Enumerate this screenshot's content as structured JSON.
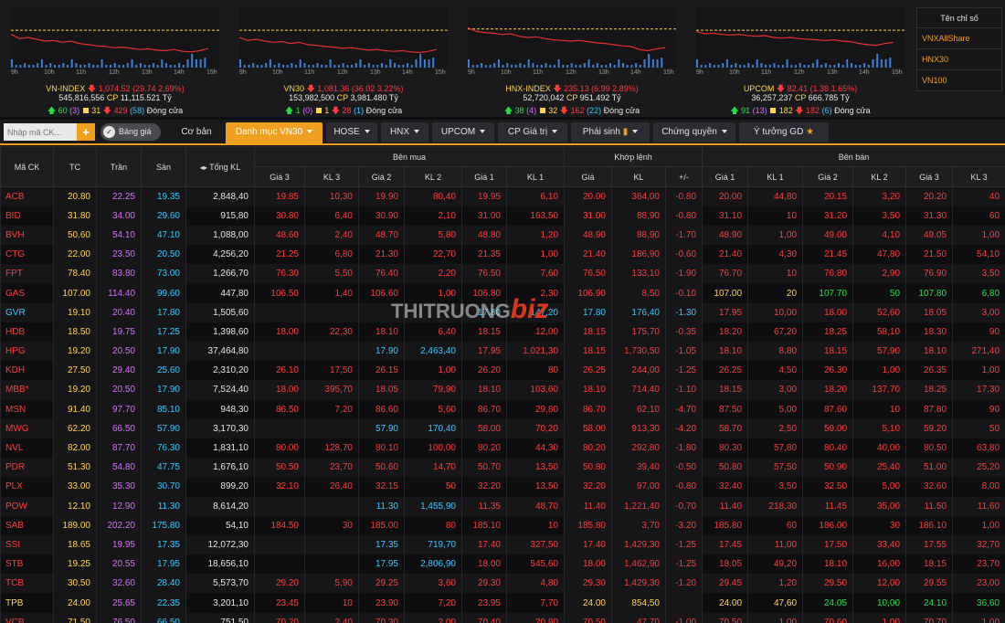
{
  "indices": [
    {
      "name": "VN-INDEX",
      "value": "1,074.52",
      "change": "(29.74 2.69%)",
      "volume": "545,816,556",
      "cp_label": "CP",
      "value_traded": "11,115.521 Tỷ",
      "up": "60",
      "ceil": "(3)",
      "ref": "31",
      "down": "429",
      "floor": "(58)",
      "status": "Đóng cửa",
      "chart_data": {
        "type": "line",
        "ref_level": 0.62,
        "series": [
          {
            "name": "price",
            "values": [
              0.55,
              0.48,
              0.5,
              0.47,
              0.44,
              0.45,
              0.42,
              0.44,
              0.4,
              0.38,
              0.36,
              0.35,
              0.33,
              0.34,
              0.32,
              0.3,
              0.31,
              0.29,
              0.28,
              0.3,
              0.27,
              0.26,
              0.28,
              0.32
            ]
          }
        ]
      }
    },
    {
      "name": "VN30",
      "value": "1,081.36",
      "change": "(36.02 3.22%)",
      "volume": "153,982,500",
      "cp_label": "CP",
      "value_traded": "3,981.480 Tỷ",
      "up": "1",
      "ceil": "(0)",
      "ref": "1",
      "down": "28",
      "floor": "(1)",
      "status": "Đóng cửa",
      "chart_data": {
        "type": "line",
        "ref_level": 0.62,
        "series": [
          {
            "name": "price",
            "values": [
              0.5,
              0.45,
              0.47,
              0.44,
              0.42,
              0.43,
              0.4,
              0.42,
              0.38,
              0.37,
              0.35,
              0.34,
              0.32,
              0.33,
              0.31,
              0.29,
              0.3,
              0.28,
              0.27,
              0.28,
              0.26,
              0.25,
              0.27,
              0.3
            ]
          }
        ]
      }
    },
    {
      "name": "HNX-INDEX",
      "value": "235.13",
      "change": "(6.99 2.89%)",
      "volume": "52,720,042",
      "cp_label": "CP",
      "value_traded": "951.492 Tỷ",
      "up": "38",
      "ceil": "(4)",
      "ref": "32",
      "down": "162",
      "floor": "(22)",
      "status": "Đóng cửa",
      "chart_data": {
        "type": "line",
        "ref_level": 0.64,
        "series": [
          {
            "name": "price",
            "values": [
              0.66,
              0.6,
              0.58,
              0.57,
              0.55,
              0.56,
              0.52,
              0.5,
              0.51,
              0.48,
              0.46,
              0.45,
              0.44,
              0.45,
              0.43,
              0.41,
              0.4,
              0.38,
              0.36,
              0.35,
              0.3,
              0.28,
              0.31,
              0.33
            ]
          }
        ]
      }
    },
    {
      "name": "UPCOM",
      "value": "82.41",
      "change": "(1.38 1.65%)",
      "volume": "36,257,237",
      "cp_label": "CP",
      "value_traded": "666.785 Tỷ",
      "up": "91",
      "ceil": "(13)",
      "ref": "182",
      "down": "182",
      "floor": "(6)",
      "status": "Đóng cửa",
      "chart_data": {
        "type": "line",
        "ref_level": 0.62,
        "series": [
          {
            "name": "price",
            "values": [
              0.6,
              0.56,
              0.57,
              0.55,
              0.54,
              0.55,
              0.53,
              0.52,
              0.53,
              0.5,
              0.49,
              0.5,
              0.48,
              0.47,
              0.46,
              0.45,
              0.46,
              0.44,
              0.43,
              0.4,
              0.38,
              0.37,
              0.4,
              0.42
            ]
          }
        ]
      }
    }
  ],
  "axis_ticks": [
    "9h",
    "10h",
    "11h",
    "12h",
    "13h",
    "14h",
    "15h"
  ],
  "index_list": {
    "header": "Tên chỉ số",
    "items": [
      "VNXAllShare",
      "HNX30",
      "VN100"
    ]
  },
  "toolbar": {
    "search_placeholder": "Nhập mã CK...",
    "plus": "+",
    "toggle_label": "Bảng giá",
    "tabs": [
      "Cơ bản",
      "Danh mục VN30",
      "HOSE",
      "HNX",
      "UPCOM",
      "CP Giá trị",
      "Phái sinh",
      "Chứng quyền",
      "Ý tưởng GD"
    ]
  },
  "table": {
    "group_headers": [
      "Bên mua",
      "Khớp lệnh",
      "Bên bán"
    ],
    "headers": [
      "Mã CK",
      "TC",
      "Trần",
      "Sàn",
      "Tổng KL",
      "Giá 3",
      "KL 3",
      "Giá 2",
      "KL 2",
      "Giá 1",
      "KL 1",
      "Giá",
      "KL",
      "+/-",
      "Giá 1",
      "KL 1",
      "Giá 2",
      "KL 2",
      "Giá 3",
      "KL 3"
    ],
    "rows": [
      [
        "ACB",
        "20.80",
        "22.25",
        "19.35",
        "2,848,40",
        "19.85",
        "10,30",
        "19.90",
        "80,40",
        "19.95",
        "6,10",
        "20.00",
        "364,00",
        "-0.80",
        "20.00",
        "44,80",
        "20.15",
        "3,20",
        "20.20",
        "40"
      ],
      [
        "BID",
        "31.80",
        "34.00",
        "29.60",
        "915,80",
        "30.80",
        "6,40",
        "30.90",
        "2,10",
        "31.00",
        "163,50",
        "31.00",
        "88,90",
        "-0.80",
        "31.10",
        "10",
        "31.20",
        "3,50",
        "31.30",
        "60"
      ],
      [
        "BVH",
        "50.60",
        "54.10",
        "47.10",
        "1,088,00",
        "48.60",
        "2,40",
        "48.70",
        "5,80",
        "48.80",
        "1,20",
        "48.90",
        "88,90",
        "-1.70",
        "48.90",
        "1,00",
        "49.00",
        "4,10",
        "49.05",
        "1,00"
      ],
      [
        "CTG",
        "22.00",
        "23.50",
        "20.50",
        "4,256,20",
        "21.25",
        "6,80",
        "21.30",
        "22,70",
        "21.35",
        "1,00",
        "21.40",
        "186,90",
        "-0.60",
        "21.40",
        "4,30",
        "21.45",
        "47,80",
        "21.50",
        "54,10"
      ],
      [
        "FPT",
        "78.40",
        "83.80",
        "73.00",
        "1,266,70",
        "76.30",
        "5,50",
        "76.40",
        "2,20",
        "76.50",
        "7,60",
        "76.50",
        "133,10",
        "-1.90",
        "76.70",
        "10",
        "76.80",
        "2,90",
        "76.90",
        "3,50"
      ],
      [
        "GAS",
        "107.00",
        "114.40",
        "99.60",
        "447,80",
        "106.50",
        "1,40",
        "106.60",
        "1,00",
        "106.80",
        "2,30",
        "106.90",
        "8,50",
        "-0.10",
        "107.00",
        "20",
        "107.70",
        "50",
        "107.80",
        "6,80"
      ],
      [
        "GVR",
        "19.10",
        "20.40",
        "17.80",
        "1,505,60",
        "",
        "",
        "",
        "",
        "17.80",
        "147,20",
        "17.80",
        "176,40",
        "-1.30",
        "17.95",
        "10,00",
        "18.00",
        "52,60",
        "18.05",
        "3,00"
      ],
      [
        "HDB",
        "18.50",
        "19.75",
        "17.25",
        "1,398,60",
        "18.00",
        "22,30",
        "18.10",
        "6,40",
        "18.15",
        "12,00",
        "18.15",
        "175,70",
        "-0.35",
        "18.20",
        "67,20",
        "18.25",
        "58,10",
        "18.30",
        "90"
      ],
      [
        "HPG",
        "19.20",
        "20.50",
        "17.90",
        "37,464,80",
        "",
        "",
        "17.90",
        "2,463,40",
        "17.95",
        "1,021,30",
        "18.15",
        "1,730,50",
        "-1.05",
        "18.10",
        "8,80",
        "18.15",
        "57,90",
        "18.10",
        "271,40"
      ],
      [
        "KDH",
        "27.50",
        "29.40",
        "25.60",
        "2,310,20",
        "26.10",
        "17,50",
        "26.15",
        "1,00",
        "26.20",
        "80",
        "26.25",
        "244,00",
        "-1.25",
        "26.25",
        "4,50",
        "26.30",
        "1,00",
        "26.35",
        "1,00"
      ],
      [
        "MBB*",
        "19.20",
        "20.50",
        "17.90",
        "7,524,40",
        "18.00",
        "395,70",
        "18.05",
        "79,90",
        "18.10",
        "103,60",
        "18.10",
        "714,40",
        "-1.10",
        "18.15",
        "3,00",
        "18.20",
        "137,70",
        "18.25",
        "17,30"
      ],
      [
        "MSN",
        "91.40",
        "97.70",
        "85.10",
        "948,30",
        "86.50",
        "7,20",
        "86.60",
        "5,60",
        "86.70",
        "29,80",
        "86.70",
        "62,10",
        "-4.70",
        "87.50",
        "5,00",
        "87.60",
        "10",
        "87.80",
        "90"
      ],
      [
        "MWG",
        "62.20",
        "66.50",
        "57.90",
        "3,170,30",
        "",
        "",
        "57.90",
        "170,40",
        "58.00",
        "70,20",
        "58.00",
        "913,30",
        "-4.20",
        "58.70",
        "2,50",
        "59.00",
        "5,10",
        "59.20",
        "50"
      ],
      [
        "NVL",
        "82.00",
        "87.70",
        "76.30",
        "1,831,10",
        "80.00",
        "128,70",
        "80.10",
        "100,00",
        "80.20",
        "44,30",
        "80.20",
        "292,80",
        "-1.80",
        "80.30",
        "57,80",
        "80.40",
        "40,00",
        "80.50",
        "63,80"
      ],
      [
        "PDR",
        "51.30",
        "54.80",
        "47.75",
        "1,676,10",
        "50.50",
        "23,70",
        "50.60",
        "14,70",
        "50.70",
        "13,50",
        "50.80",
        "39,40",
        "-0.50",
        "50.80",
        "57,50",
        "50.90",
        "25,40",
        "51.00",
        "25,20"
      ],
      [
        "PLX",
        "33.00",
        "35.30",
        "30.70",
        "899,20",
        "32.10",
        "26,40",
        "32.15",
        "50",
        "32.20",
        "13,50",
        "32.20",
        "97,00",
        "-0.80",
        "32.40",
        "3,50",
        "32.50",
        "5,00",
        "32.60",
        "8,00"
      ],
      [
        "POW",
        "12.10",
        "12.90",
        "11.30",
        "8,614,20",
        "",
        "",
        "11.30",
        "1,455,90",
        "11.35",
        "48,70",
        "11.40",
        "1,221,40",
        "-0.70",
        "11.40",
        "218,30",
        "11.45",
        "35,00",
        "11.50",
        "11,60"
      ],
      [
        "SAB",
        "189.00",
        "202.20",
        "175.80",
        "54,10",
        "184.50",
        "30",
        "185.00",
        "80",
        "185.10",
        "10",
        "185.80",
        "3,70",
        "-3.20",
        "185.80",
        "60",
        "186.00",
        "30",
        "186.10",
        "1,00"
      ],
      [
        "SSI",
        "18.65",
        "19.95",
        "17.35",
        "12,072,30",
        "",
        "",
        "17.35",
        "719,70",
        "17.40",
        "327,50",
        "17.40",
        "1,429,30",
        "-1.25",
        "17.45",
        "11,00",
        "17.50",
        "33,40",
        "17.55",
        "32,70"
      ],
      [
        "STB",
        "19.25",
        "20.55",
        "17.95",
        "18,656,10",
        "",
        "",
        "17.95",
        "2,806,90",
        "18.00",
        "545,60",
        "18.00",
        "1,462,90",
        "-1.25",
        "18.05",
        "49,20",
        "18.10",
        "16,00",
        "18.15",
        "23,70"
      ],
      [
        "TCB",
        "30.50",
        "32.60",
        "28.40",
        "5,573,70",
        "29.20",
        "5,90",
        "29.25",
        "3,60",
        "29.30",
        "4,80",
        "29.30",
        "1,429,30",
        "-1.20",
        "29.45",
        "1,20",
        "29.50",
        "12,00",
        "29.55",
        "23,00"
      ],
      [
        "TPB",
        "24.00",
        "25.65",
        "22.35",
        "3,201,10",
        "23.45",
        "10",
        "23.90",
        "7,20",
        "23.95",
        "7,70",
        "24.00",
        "854,50",
        "",
        "24.00",
        "47,60",
        "24.05",
        "10,00",
        "24.10",
        "36,60"
      ],
      [
        "VCB",
        "71.50",
        "76.50",
        "66.50",
        "751,50",
        "70.20",
        "2,40",
        "70.30",
        "2,00",
        "70.40",
        "20,80",
        "70.50",
        "47,70",
        "-1.00",
        "70.50",
        "1,00",
        "70.60",
        "1,00",
        "70.70",
        "1,00"
      ]
    ]
  },
  "watermark": {
    "left": "THITRUONG",
    "right": "biz"
  },
  "colors": {
    "up": "#1ee34a",
    "ref": "#ffd54a",
    "down": "#ff3b3b",
    "ceil": "#d76bff",
    "floor": "#38c7ff",
    "accent": "#f0a020"
  }
}
